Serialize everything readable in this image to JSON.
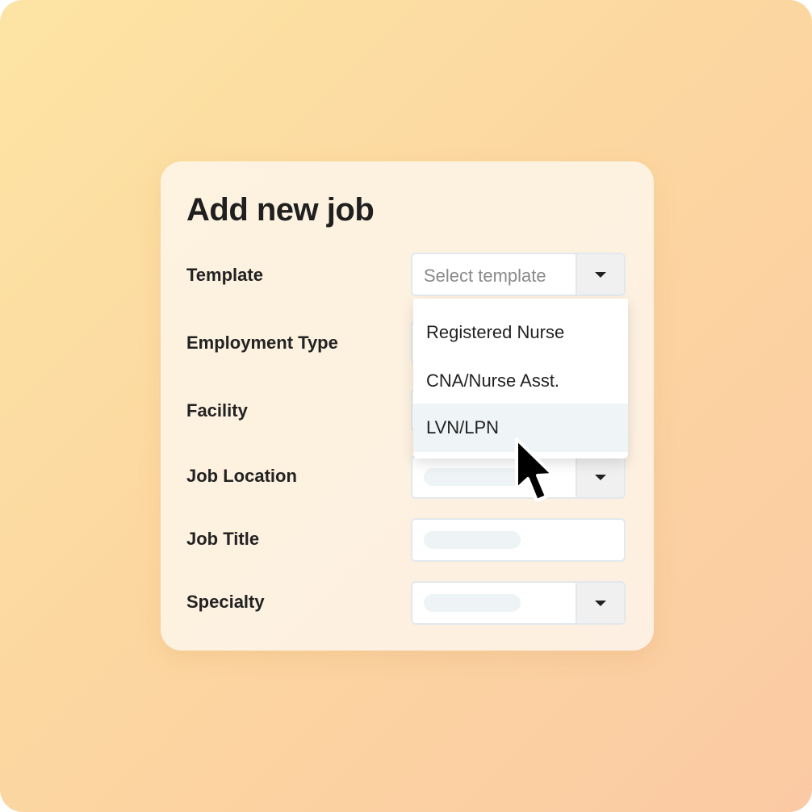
{
  "form": {
    "title": "Add new job",
    "fields": [
      {
        "label": "Template",
        "type": "select",
        "placeholder": "Select template"
      },
      {
        "label": "Employment Type",
        "type": "select"
      },
      {
        "label": "Facility",
        "type": "select"
      },
      {
        "label": "Job Location",
        "type": "select"
      },
      {
        "label": "Job Title",
        "type": "text"
      },
      {
        "label": "Specialty",
        "type": "select"
      }
    ]
  },
  "dropdown": {
    "options": [
      "Registered Nurse",
      "CNA/Nurse Asst.",
      "LVN/LPN"
    ],
    "highlighted_index": 2
  },
  "icons": {
    "caret": "caret-down-icon",
    "cursor": "mouse-pointer-icon"
  },
  "colors": {
    "highlight": "#eff4f6",
    "text": "#1f1f1f",
    "placeholder": "#8a8a8a"
  }
}
